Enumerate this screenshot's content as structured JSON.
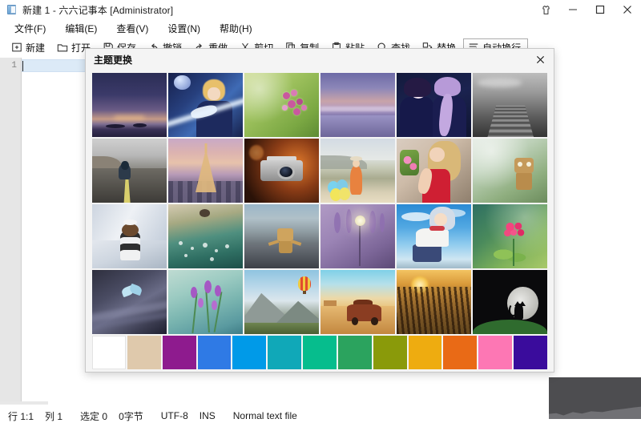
{
  "window": {
    "title": "新建 1 - 六六记事本 [Administrator]",
    "icon": "notepad-icon",
    "controls": [
      {
        "name": "theme-button",
        "glyph": "theme-shirt-icon"
      },
      {
        "name": "minimize-button",
        "glyph": "minimize-icon"
      },
      {
        "name": "maximize-button",
        "glyph": "maximize-icon"
      },
      {
        "name": "close-button",
        "glyph": "close-icon"
      }
    ]
  },
  "menubar": {
    "items": [
      {
        "label": "文件(F)",
        "accel": "F"
      },
      {
        "label": "编辑(E)",
        "accel": "E"
      },
      {
        "label": "查看(V)",
        "accel": "V"
      },
      {
        "label": "设置(N)",
        "accel": "N"
      },
      {
        "label": "帮助(H)",
        "accel": "H"
      }
    ]
  },
  "toolbar": {
    "items": [
      {
        "label": "新建",
        "icon": "new-file-icon",
        "active": false
      },
      {
        "label": "打开",
        "icon": "open-folder-icon",
        "active": false
      },
      {
        "label": "保存",
        "icon": "save-disk-icon",
        "active": false
      },
      {
        "label": "撤销",
        "icon": "undo-arrow-icon",
        "active": false
      },
      {
        "label": "重做",
        "icon": "redo-arrow-icon",
        "active": false
      },
      {
        "label": "剪切",
        "icon": "cut-scissors-icon",
        "active": false
      },
      {
        "label": "复制",
        "icon": "copy-icon",
        "active": false
      },
      {
        "label": "粘贴",
        "icon": "paste-icon",
        "active": false
      },
      {
        "label": "查找",
        "icon": "search-magnifier-icon",
        "active": false
      },
      {
        "label": "替换",
        "icon": "replace-icon",
        "active": false
      },
      {
        "label": "自动换行",
        "icon": "word-wrap-icon",
        "active": true
      }
    ]
  },
  "editor": {
    "line_numbers": [
      "1"
    ],
    "content": ""
  },
  "statusbar": {
    "items": [
      {
        "name": "caret-position",
        "text": "行 1:1"
      },
      {
        "name": "column-indicator",
        "text": "列 1"
      },
      {
        "name": "selection-count",
        "text": "选定 0"
      },
      {
        "name": "byte-count",
        "text": "0字节"
      },
      {
        "name": "encoding",
        "text": "UTF-8"
      },
      {
        "name": "insert-mode",
        "text": "INS"
      },
      {
        "name": "file-type",
        "text": "Normal text file"
      }
    ]
  },
  "theme_dialog": {
    "title": "主题更换",
    "close_label": "×",
    "thumbnails": [
      {
        "name": "thumb-night-sky-sea",
        "cls": "t1",
        "alt": "夜空海面"
      },
      {
        "name": "thumb-anime-knight",
        "cls": "t2",
        "alt": "动漫骑士"
      },
      {
        "name": "thumb-lilac-flowers",
        "cls": "t3",
        "alt": "紫丁香花"
      },
      {
        "name": "thumb-purple-beach",
        "cls": "t4",
        "alt": "紫色海滩"
      },
      {
        "name": "thumb-anime-duo-purple",
        "cls": "t5",
        "alt": "紫发少女"
      },
      {
        "name": "thumb-bw-pier",
        "cls": "t6",
        "alt": "黑白栈桥"
      },
      {
        "name": "thumb-motorcycle-road",
        "cls": "t7",
        "alt": "摩托公路"
      },
      {
        "name": "thumb-eiffel-tower",
        "cls": "t8",
        "alt": "埃菲尔铁塔"
      },
      {
        "name": "thumb-vintage-camera",
        "cls": "t9",
        "alt": "复古相机"
      },
      {
        "name": "thumb-girl-balloons",
        "cls": "t10",
        "alt": "女孩气球"
      },
      {
        "name": "thumb-red-dress-girl",
        "cls": "t11",
        "alt": "红裙女孩"
      },
      {
        "name": "thumb-danbo-green",
        "cls": "t12",
        "alt": "阿楞绿野"
      },
      {
        "name": "thumb-plush-snow",
        "cls": "t13",
        "alt": "雪地玩偶"
      },
      {
        "name": "thumb-dew-drops",
        "cls": "t14",
        "alt": "露珠"
      },
      {
        "name": "thumb-danbo-rocks",
        "cls": "t15",
        "alt": "阿楞石滩"
      },
      {
        "name": "thumb-wisteria-lamp",
        "cls": "t16",
        "alt": "紫藤灯"
      },
      {
        "name": "thumb-anime-girl-sky",
        "cls": "t17",
        "alt": "天空少女"
      },
      {
        "name": "thumb-pink-flower",
        "cls": "t18",
        "alt": "粉色花朵"
      },
      {
        "name": "thumb-butterfly-dark",
        "cls": "t19",
        "alt": "暗色蝴蝶"
      },
      {
        "name": "thumb-lavender-stems",
        "cls": "t20",
        "alt": "薰衣草"
      },
      {
        "name": "thumb-balloon-mountain",
        "cls": "t21",
        "alt": "热气球山脉"
      },
      {
        "name": "thumb-desert-car",
        "cls": "t22",
        "alt": "沙漠汽车"
      },
      {
        "name": "thumb-golden-wheat",
        "cls": "t23",
        "alt": "金色麦田"
      },
      {
        "name": "thumb-cat-moon",
        "cls": "t24",
        "alt": "月下黑猫"
      }
    ],
    "swatches": [
      {
        "name": "swatch-white",
        "color": "#ffffff"
      },
      {
        "name": "swatch-tan",
        "color": "#dfc9ac"
      },
      {
        "name": "swatch-magenta",
        "color": "#8e1b8e"
      },
      {
        "name": "swatch-royal-blue",
        "color": "#2f7ae5"
      },
      {
        "name": "swatch-sky-blue",
        "color": "#009ae8"
      },
      {
        "name": "swatch-teal",
        "color": "#10a8b8"
      },
      {
        "name": "swatch-emerald",
        "color": "#06bd8d"
      },
      {
        "name": "swatch-green",
        "color": "#2ba35e"
      },
      {
        "name": "swatch-olive",
        "color": "#8a9a0a"
      },
      {
        "name": "swatch-amber",
        "color": "#eeac10"
      },
      {
        "name": "swatch-orange",
        "color": "#e96a16"
      },
      {
        "name": "swatch-pink",
        "color": "#fd77b4"
      },
      {
        "name": "swatch-indigo",
        "color": "#3a0c9c"
      }
    ]
  }
}
